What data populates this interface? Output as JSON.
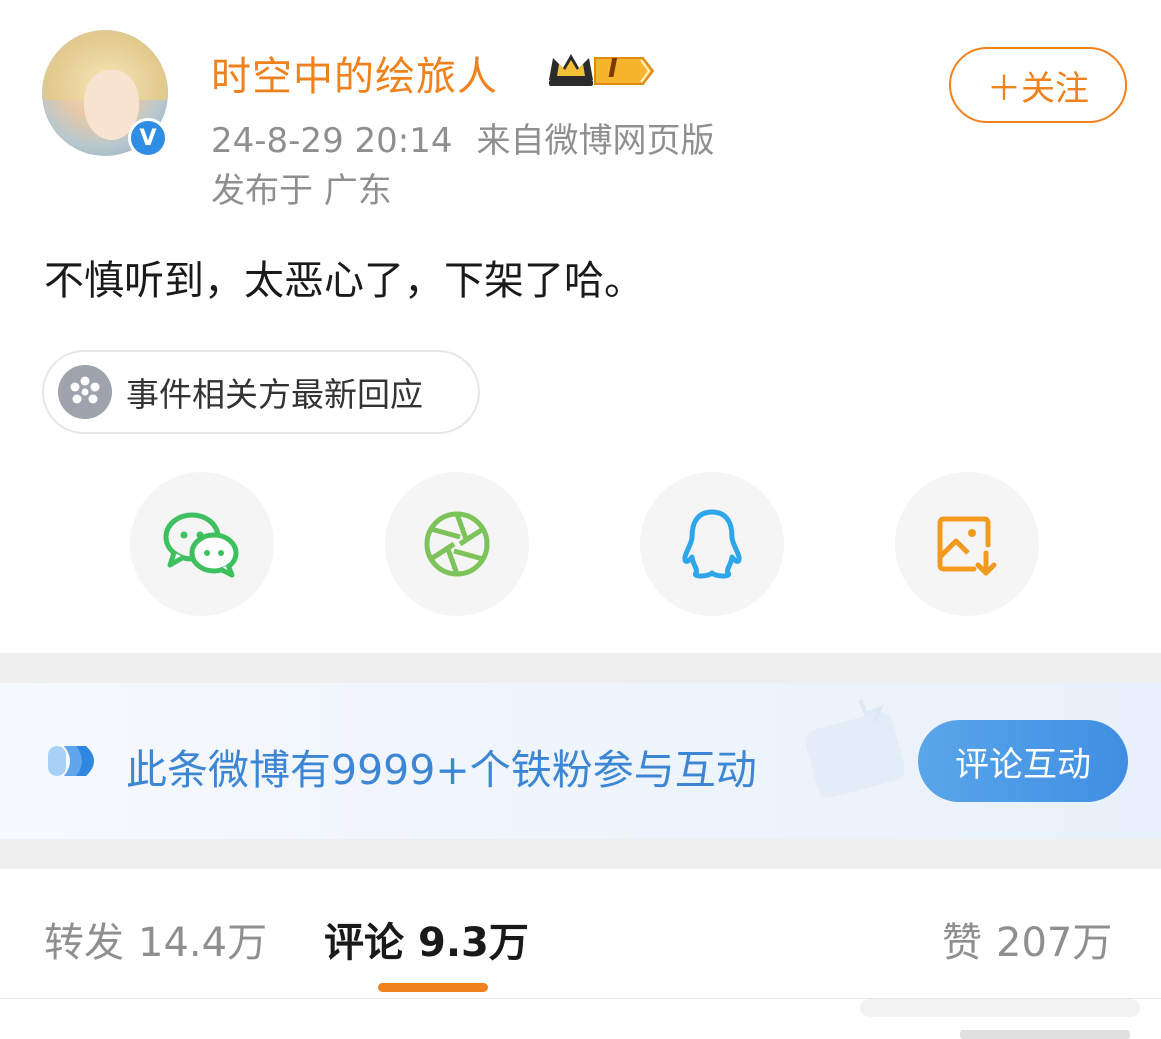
{
  "post": {
    "username": "时空中的绘旅人",
    "vip_level": "I",
    "follow_label": "＋关注",
    "timestamp": "24-8-29 20:14",
    "source": "来自微博网页版",
    "location": "发布于 广东",
    "text": "不慎听到，太恶心了，下架了哈。"
  },
  "event_chip": {
    "label": "事件相关方最新回应"
  },
  "share": {
    "items": [
      "wechat-icon",
      "moments-icon",
      "qq-icon",
      "save-image-icon"
    ]
  },
  "fans_banner": {
    "text": "此条微博有9999+个铁粉参与互动",
    "button_label": "评论互动"
  },
  "tabs": {
    "repost": {
      "label": "转发",
      "count": "14.4万"
    },
    "comment": {
      "label": "评论",
      "count": "9.3万"
    },
    "like": {
      "label": "赞",
      "count": "207万"
    }
  },
  "colors": {
    "accent": "#f0821e",
    "link_blue": "#3d86d4",
    "wechat_green": "#3fc05f",
    "qq_blue": "#2fa6ea",
    "save_orange": "#f29a1f"
  }
}
